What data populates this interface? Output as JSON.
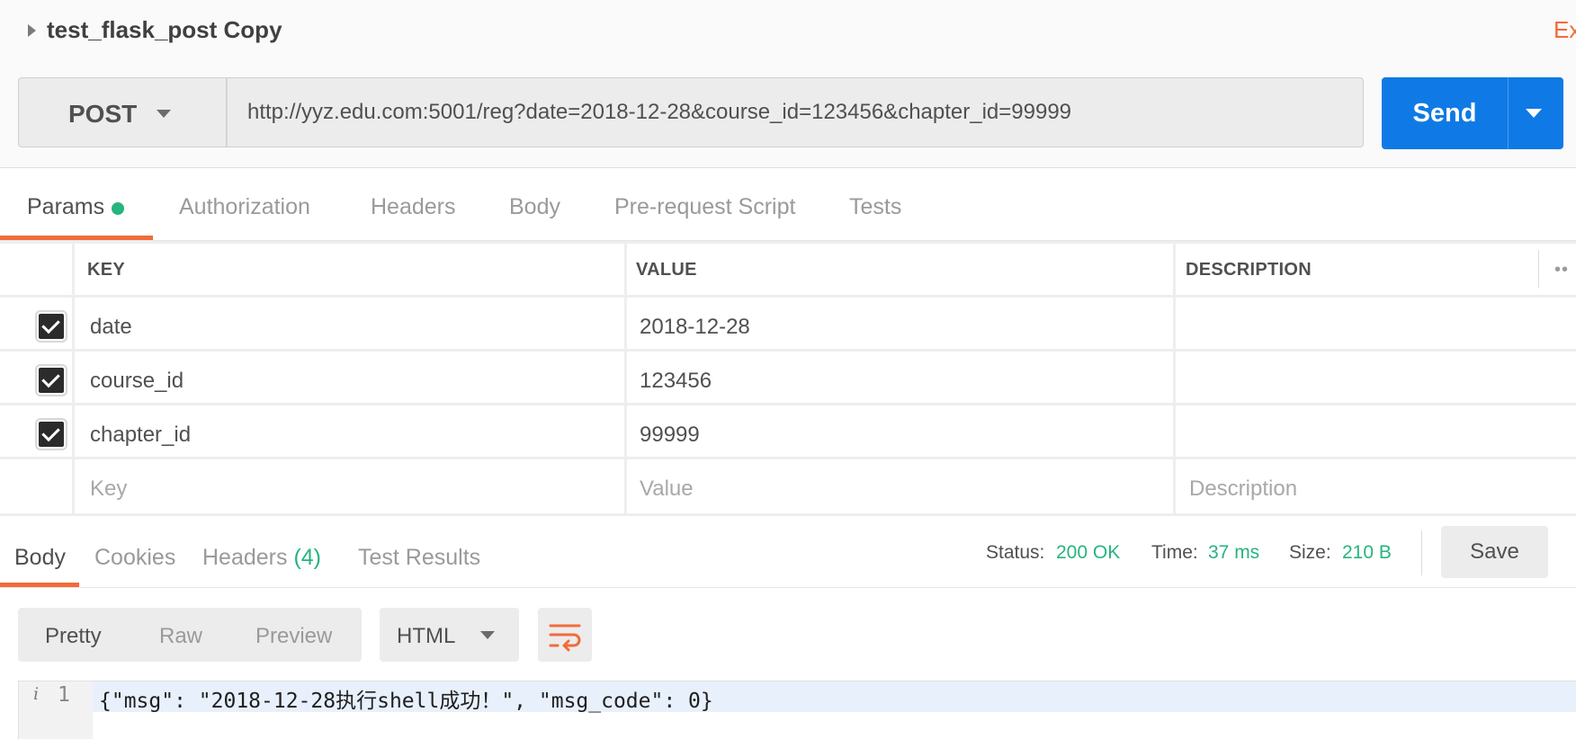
{
  "request": {
    "title": "test_flask_post Copy",
    "examples_label": "Ex",
    "method": "POST",
    "url": "http://yyz.edu.com:5001/reg?date=2018-12-28&course_id=123456&chapter_id=99999",
    "send_label": "Send"
  },
  "request_tabs": [
    {
      "label": "Params",
      "active": true,
      "indicator_color": "#26b47f"
    },
    {
      "label": "Authorization"
    },
    {
      "label": "Headers"
    },
    {
      "label": "Body"
    },
    {
      "label": "Pre-request Script"
    },
    {
      "label": "Tests"
    }
  ],
  "params": {
    "headers": {
      "key": "KEY",
      "value": "VALUE",
      "description": "DESCRIPTION",
      "more": "••"
    },
    "rows": [
      {
        "checked": true,
        "key": "date",
        "value": "2018-12-28",
        "description": ""
      },
      {
        "checked": true,
        "key": "course_id",
        "value": "123456",
        "description": ""
      },
      {
        "checked": true,
        "key": "chapter_id",
        "value": "99999",
        "description": ""
      }
    ],
    "placeholders": {
      "key": "Key",
      "value": "Value",
      "description": "Description"
    }
  },
  "response": {
    "tabs": {
      "body": "Body",
      "cookies": "Cookies",
      "headers": "Headers",
      "headers_count": "(4)",
      "test_results": "Test Results"
    },
    "status_label": "Status:",
    "status": "200 OK",
    "time_label": "Time:",
    "time": "37 ms",
    "size_label": "Size:",
    "size": "210 B",
    "save_label": "Save",
    "views": {
      "pretty": "Pretty",
      "raw": "Raw",
      "preview": "Preview"
    },
    "format": "HTML",
    "line_number": "1",
    "info_marker": "i",
    "code": "{\"msg\": \"2018-12-28执行shell成功！\", \"msg_code\": 0}"
  },
  "colors": {
    "accent": "#f26b3a",
    "send": "#0f7ae5",
    "success": "#26b47f"
  },
  "icons": [
    "caret-right-icon",
    "chevron-down-icon",
    "checkbox-checked-icon",
    "more-icon",
    "wrap-lines-icon",
    "info-icon"
  ]
}
